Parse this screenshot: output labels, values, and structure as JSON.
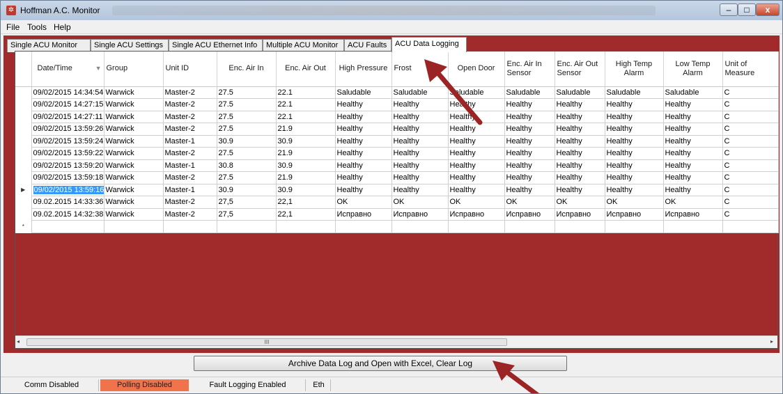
{
  "window": {
    "title": "Hoffman A.C. Monitor",
    "app_icon": "snowflake-icon",
    "controls": {
      "minimize": "–",
      "maximize": "□",
      "close": "x"
    }
  },
  "menu": [
    "File",
    "Tools",
    "Help"
  ],
  "tabs": [
    {
      "label": "Single ACU Monitor"
    },
    {
      "label": "Single ACU Settings"
    },
    {
      "label": "Single ACU Ethernet Info"
    },
    {
      "label": "Multiple ACU Monitor"
    },
    {
      "label": "ACU Faults"
    },
    {
      "label": "ACU Data Logging",
      "active": true
    }
  ],
  "grid": {
    "columns": [
      "Date/Time",
      "Group",
      "Unit ID",
      "Enc. Air In",
      "Enc. Air Out",
      "High Pressure",
      "Frost",
      "Open Door",
      "Enc. Air In Sensor",
      "Enc. Air Out Sensor",
      "High Temp Alarm",
      "Low Temp Alarm",
      "Unit of Measure"
    ],
    "sort_glyph": "▼",
    "rows": [
      [
        "09/02/2015 14:34:54",
        "Warwick",
        "Master-2",
        "27.5",
        "22.1",
        "Saludable",
        "Saludable",
        "Saludable",
        "Saludable",
        "Saludable",
        "Saludable",
        "Saludable",
        "C"
      ],
      [
        "09/02/2015 14:27:15",
        "Warwick",
        "Master-2",
        "27.5",
        "22.1",
        "Healthy",
        "Healthy",
        "Healthy",
        "Healthy",
        "Healthy",
        "Healthy",
        "Healthy",
        "C"
      ],
      [
        "09/02/2015 14:27:11",
        "Warwick",
        "Master-2",
        "27.5",
        "22.1",
        "Healthy",
        "Healthy",
        "Healthy",
        "Healthy",
        "Healthy",
        "Healthy",
        "Healthy",
        "C"
      ],
      [
        "09/02/2015 13:59:26",
        "Warwick",
        "Master-2",
        "27.5",
        "21.9",
        "Healthy",
        "Healthy",
        "Healthy",
        "Healthy",
        "Healthy",
        "Healthy",
        "Healthy",
        "C"
      ],
      [
        "09/02/2015 13:59:24",
        "Warwick",
        "Master-1",
        "30.9",
        "30.9",
        "Healthy",
        "Healthy",
        "Healthy",
        "Healthy",
        "Healthy",
        "Healthy",
        "Healthy",
        "C"
      ],
      [
        "09/02/2015 13:59:22",
        "Warwick",
        "Master-2",
        "27.5",
        "21.9",
        "Healthy",
        "Healthy",
        "Healthy",
        "Healthy",
        "Healthy",
        "Healthy",
        "Healthy",
        "C"
      ],
      [
        "09/02/2015 13:59:20",
        "Warwick",
        "Master-1",
        "30.8",
        "30.9",
        "Healthy",
        "Healthy",
        "Healthy",
        "Healthy",
        "Healthy",
        "Healthy",
        "Healthy",
        "C"
      ],
      [
        "09/02/2015 13:59:18",
        "Warwick",
        "Master-2",
        "27.5",
        "21.9",
        "Healthy",
        "Healthy",
        "Healthy",
        "Healthy",
        "Healthy",
        "Healthy",
        "Healthy",
        "C"
      ],
      [
        "09/02/2015 13:59:16",
        "Warwick",
        "Master-1",
        "30.9",
        "30.9",
        "Healthy",
        "Healthy",
        "Healthy",
        "Healthy",
        "Healthy",
        "Healthy",
        "Healthy",
        "C"
      ],
      [
        "09.02.2015 14:33:36",
        "Warwick",
        "Master-2",
        "27,5",
        "22,1",
        "OK",
        "OK",
        "OK",
        "OK",
        "OK",
        "OK",
        "OK",
        "C"
      ],
      [
        "09.02.2015 14:32:38",
        "Warwick",
        "Master-2",
        "27,5",
        "22,1",
        "Исправно",
        "Исправно",
        "Исправно",
        "Исправно",
        "Исправно",
        "Исправно",
        "Исправно",
        "C"
      ]
    ],
    "current_row_index": 8,
    "current_row_glyph": "▶",
    "new_row_glyph": "*",
    "hscroll": {
      "left": "◂",
      "right": "▸",
      "thumb": "III"
    }
  },
  "archive_button": "Archive Data Log and Open with Excel, Clear Log",
  "status": {
    "comm": "Comm Disabled",
    "polling": "Polling Disabled",
    "fault_logging": "Fault Logging Enabled",
    "eth": "Eth"
  },
  "colors": {
    "background_panel": "#a12b2b",
    "selection": "#3399ff",
    "polling_status": "#f0734b",
    "annotation_arrow": "#9b2424"
  },
  "annotations": [
    "arrow-to-frost-column",
    "arrow-to-archive-button"
  ]
}
